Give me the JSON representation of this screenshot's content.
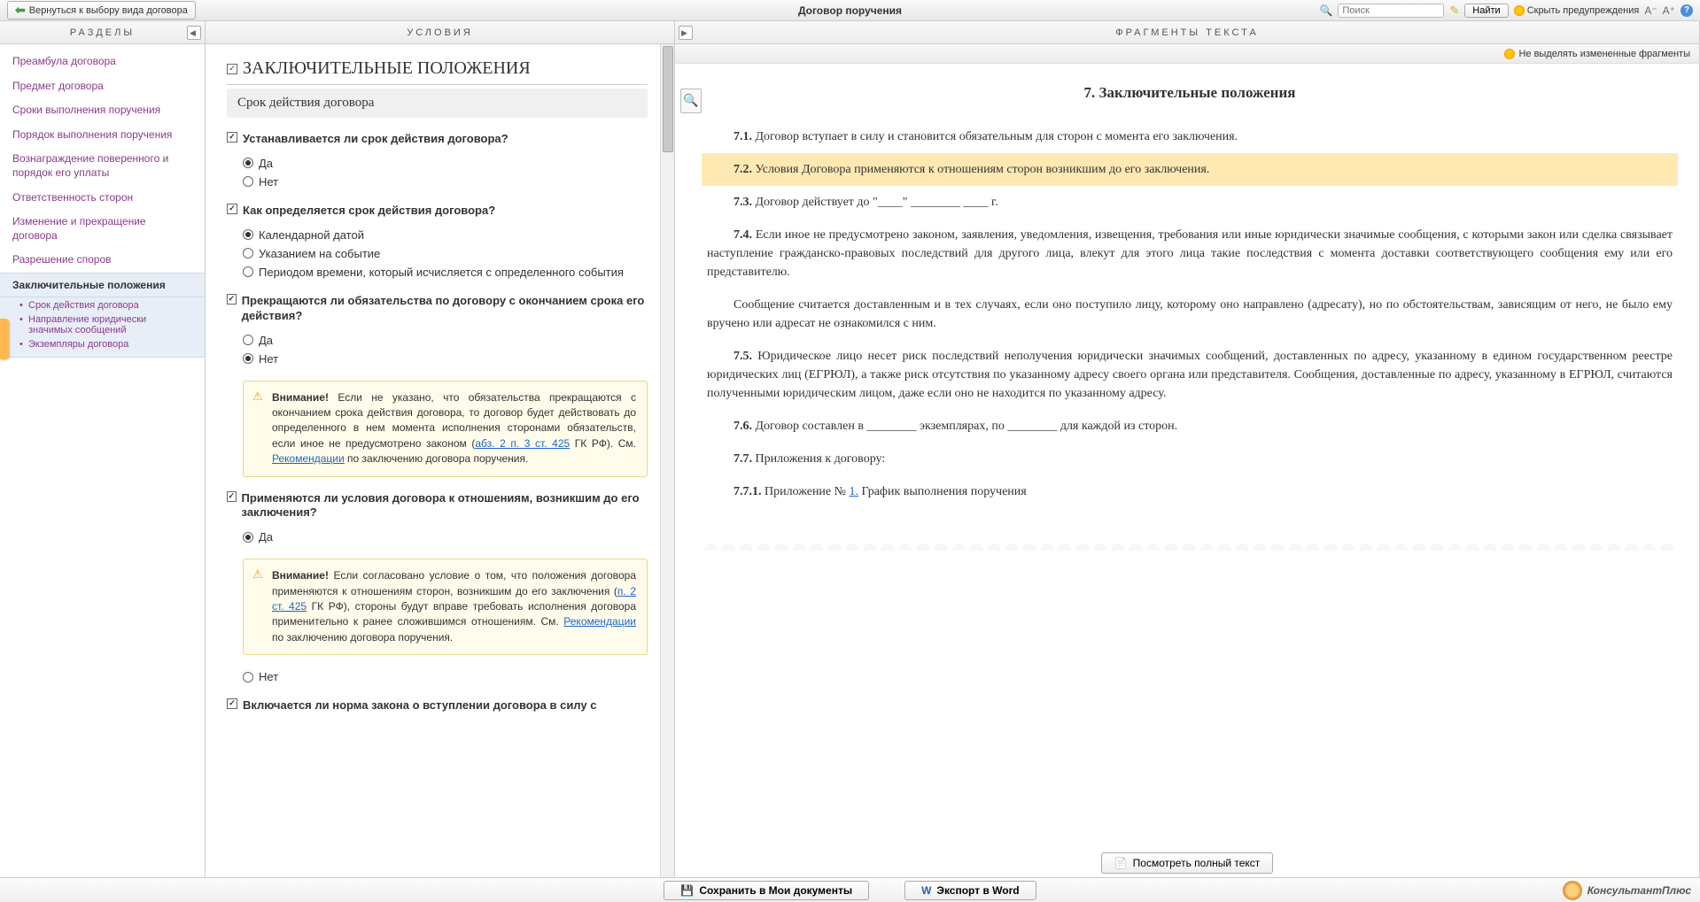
{
  "toolbar": {
    "back": "Вернуться к выбору вида договора",
    "title": "Договор поручения",
    "search_placeholder": "Поиск",
    "find": "Найти",
    "hide_warnings": "Скрыть предупреждения"
  },
  "left": {
    "title": "РАЗДЕЛЫ",
    "items": [
      "Преамбула договора",
      "Предмет договора",
      "Сроки выполнения поручения",
      "Порядок выполнения поручения",
      "Вознаграждение поверенного и порядок его уплаты",
      "Ответственность сторон",
      "Изменение и прекращение договора",
      "Разрешение споров"
    ],
    "active": "Заключительные положения",
    "subs": [
      "Срок действия договора",
      "Направление юридически значимых сообщений",
      "Экземпляры договора"
    ]
  },
  "mid": {
    "title": "УСЛОВИЯ",
    "section": "ЗАКЛЮЧИТЕЛЬНЫЕ ПОЛОЖЕНИЯ",
    "subgroup": "Срок действия договора",
    "q1": {
      "text": "Устанавливается ли срок действия договора?",
      "yes": "Да",
      "no": "Нет"
    },
    "q2": {
      "text": "Как определяется срок действия договора?",
      "o1": "Календарной датой",
      "o2": "Указанием на событие",
      "o3": "Периодом времени, который исчисляется с определенного события"
    },
    "q3": {
      "text": "Прекращаются ли обязательства по договору с окончанием срока его действия?",
      "yes": "Да",
      "no": "Нет"
    },
    "warn1": {
      "bold": "Внимание!",
      "t1": " Если не указано, что обязательства прекращаются с окончанием срока действия договора, то договор будет действовать до определенного в нем момента исполнения сторонами обязательств, если иное не предусмотрено законом (",
      "link1": "абз. 2 п. 3 ст. 425",
      "t2": " ГК РФ). См. ",
      "link2": "Рекомендации",
      "t3": " по заключению договора поручения."
    },
    "q4": {
      "text": "Применяются ли условия договора к отношениям, возникшим до его заключения?",
      "yes": "Да",
      "no": "Нет"
    },
    "warn2": {
      "bold": "Внимание!",
      "t1": " Если согласовано условие о том, что положения договора применяются к отношениям сторон, возникшим до его заключения (",
      "link1": "п. 2 ст. 425",
      "t2": " ГК РФ), стороны будут вправе требовать исполнения договора применительно к ранее сложившимся отношениям. См. ",
      "link2": "Рекомендации",
      "t3": " по заключению договора поручения."
    },
    "q5": {
      "text": "Включается ли норма закона о вступлении договора в силу с"
    }
  },
  "right": {
    "title": "ФРАГМЕНТЫ ТЕКСТА",
    "no_highlight": "Не выделять измененные фрагменты",
    "heading": "7. Заключительные положения",
    "p71n": "7.1.",
    "p71": " Договор вступает в силу и становится обязательным для сторон с момента его заключения.",
    "p72n": "7.2.",
    "p72": " Условия Договора применяются к отношениям сторон возникшим до его заключения.",
    "p73n": "7.3.",
    "p73": " Договор действует до \"____\" ________ ____ г.",
    "p74n": "7.4.",
    "p74": " Если иное не предусмотрено законом, заявления, уведомления, извещения, требования или иные юридически значимые сообщения, с которыми закон или сделка связывает наступление гражданско-правовых последствий для другого лица, влекут для этого лица такие последствия с момента доставки соответствующего сообщения ему или его представителю.",
    "p74b": "Сообщение считается доставленным и в тех случаях, если оно поступило лицу, которому оно направлено (адресату), но по обстоятельствам, зависящим от него, не было ему вручено или адресат не ознакомился с ним.",
    "p75n": "7.5.",
    "p75": " Юридическое лицо несет риск последствий неполучения юридически значимых сообщений, доставленных по адресу, указанному в едином государственном реестре юридических лиц (ЕГРЮЛ), а также риск отсутствия по указанному адресу своего органа или представителя. Сообщения, доставленные по адресу, указанному в ЕГРЮЛ, считаются полученными юридическим лицом, даже если оно не находится по указанному адресу.",
    "p76n": "7.6.",
    "p76": " Договор составлен в ________ экземплярах, по ________ для каждой из сторон.",
    "p77n": "7.7.",
    "p77": " Приложения к договору:",
    "p771n": "7.7.1.",
    "p771a": " Приложение № ",
    "p771link": "1.",
    "p771b": " График выполнения поручения",
    "view_full": "Посмотреть полный текст"
  },
  "bottom": {
    "save": "Сохранить в Мои документы",
    "export": "Экспорт в Word",
    "brand": "КонсультантПлюс"
  }
}
